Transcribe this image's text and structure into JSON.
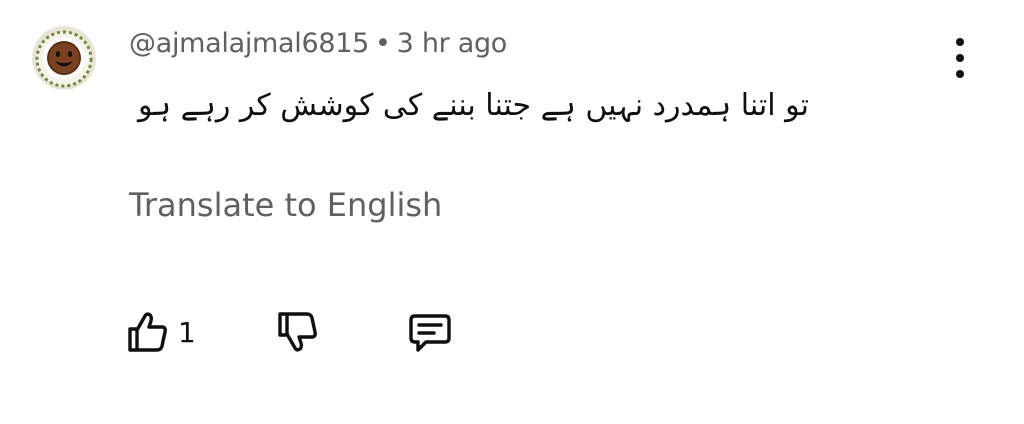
{
  "comment": {
    "author": "@ajmalajmal6815",
    "separator": "•",
    "time": "3 hr ago",
    "text": "تو اتنا ہمدرد نہیں ہے جتنا بننے کی کوشش کر رہے ہو",
    "translate_label": "Translate to English",
    "like_count": "1"
  },
  "icons": {
    "avatar": "coffee-cup-smiley-avatar",
    "more": "more-vert-icon",
    "like": "thumbs-up-icon",
    "dislike": "thumbs-down-icon",
    "reply": "comment-reply-icon"
  }
}
